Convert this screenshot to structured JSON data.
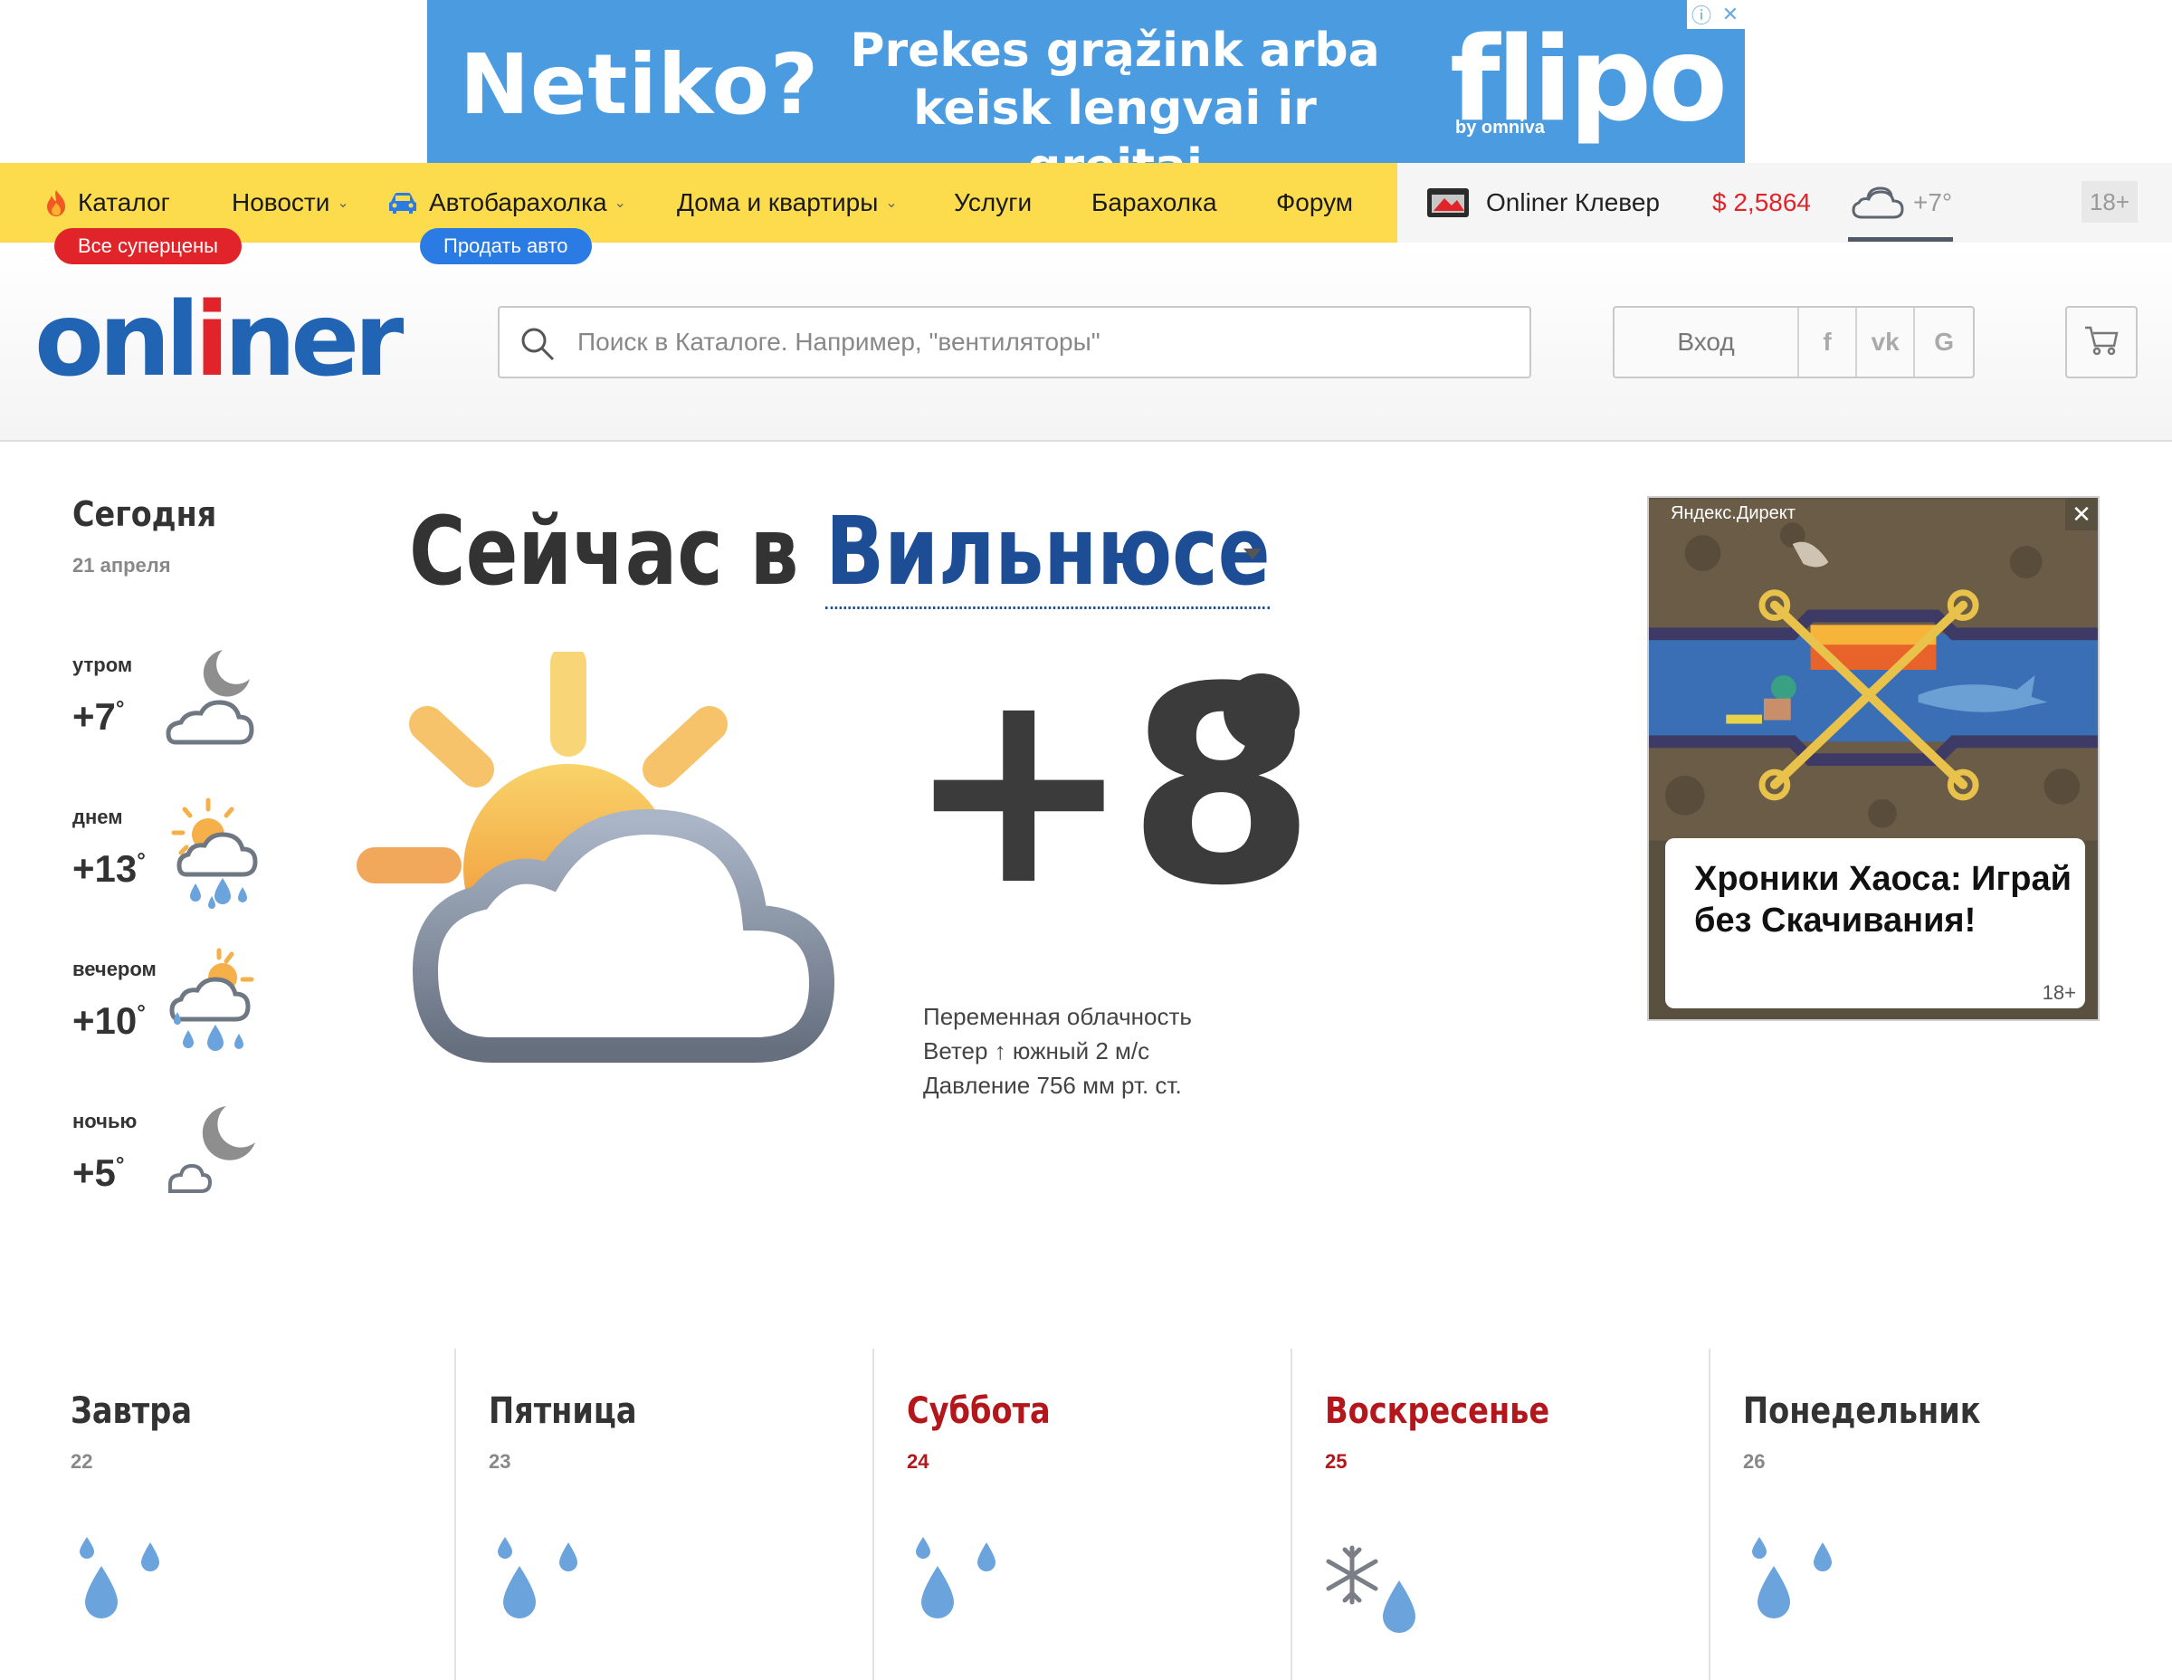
{
  "top_ad": {
    "headline": "Netiko?",
    "slogan_line1": "Prekes grąžink arba",
    "slogan_line2": "keisk lengvai ir greitai",
    "brand": "flipo",
    "brand_sub": "by omniva",
    "info_icon": "info-icon",
    "close_icon": "close-icon",
    "background": "#4a9be0"
  },
  "nav": {
    "items": [
      {
        "label": "Каталог",
        "icon": "fire-icon"
      },
      {
        "label": "Новости",
        "dropdown": true
      },
      {
        "label": "Автобарахолка",
        "icon": "car-icon",
        "dropdown": true
      },
      {
        "label": "Дома и квартиры",
        "dropdown": true
      },
      {
        "label": "Услуги"
      },
      {
        "label": "Барахолка"
      },
      {
        "label": "Форум"
      }
    ],
    "badges": {
      "catalog": "Все суперцены",
      "auto": "Продать авто"
    },
    "clever": "Onliner Клевер",
    "currency": "$ 2,5864",
    "weather_temp": "+7°",
    "age": "18+",
    "accent_yellow": "#fcdc4d",
    "currency_color": "#e0242a"
  },
  "header": {
    "logo_pre": "onl",
    "logo_mid": "i",
    "logo_post": "ner",
    "search_placeholder": "Поиск в Каталоге. Например, \"вентиляторы\"",
    "login": "Вход",
    "social": [
      "f",
      "vk",
      "G"
    ],
    "brand_blue": "#2164b3",
    "brand_red": "#e0242a"
  },
  "today": {
    "title": "Сегодня",
    "date": "21 апреля",
    "parts": [
      {
        "label": "утром",
        "temp": "+7",
        "icon": "moon-cloud-icon"
      },
      {
        "label": "днем",
        "temp": "+13",
        "icon": "sun-cloud-rain-icon"
      },
      {
        "label": "вечером",
        "temp": "+10",
        "icon": "sun-cloud-rain-icon"
      },
      {
        "label": "ночью",
        "temp": "+5",
        "icon": "moon-small-cloud-icon"
      }
    ]
  },
  "now": {
    "prefix": "Сейчас в",
    "city": "Вильнюсе",
    "temp": "+8",
    "condition": "Переменная облачность",
    "wind": "Ветер ↑ южный 2 м/с",
    "pressure": "Давление 756 мм рт. ст.",
    "icon": "sun-cloud-icon"
  },
  "side_ad": {
    "source": "Яндекс.Директ",
    "text": "Хроники Хаоса: Играй без Скачивания!",
    "age": "18+"
  },
  "forecast": [
    {
      "day": "Завтра",
      "date": "22",
      "weekend": false,
      "icon": "rain-drops-icon"
    },
    {
      "day": "Пятница",
      "date": "23",
      "weekend": false,
      "icon": "rain-drops-icon"
    },
    {
      "day": "Суббота",
      "date": "24",
      "weekend": true,
      "icon": "rain-drops-icon"
    },
    {
      "day": "Воскресенье",
      "date": "25",
      "weekend": true,
      "icon": "snow-rain-icon"
    },
    {
      "day": "Понедельник",
      "date": "26",
      "weekend": false,
      "icon": "rain-drops-icon"
    }
  ]
}
